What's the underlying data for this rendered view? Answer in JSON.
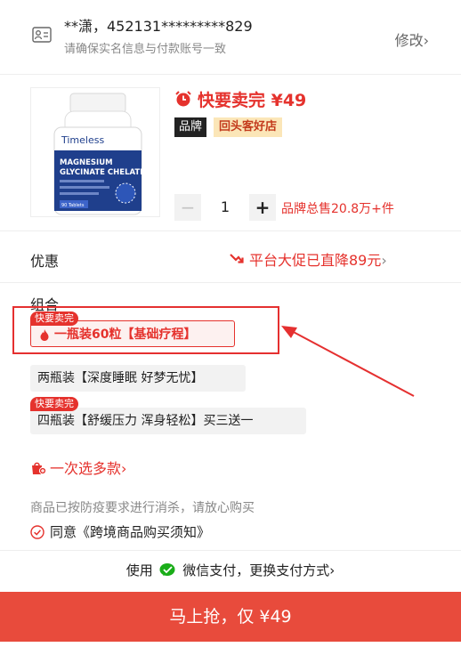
{
  "identity": {
    "name_id": "**潇，452131*********829",
    "hint": "请确保实名信息与付款账号一致",
    "modify_label": "修改",
    "modify_chevron": "›"
  },
  "product": {
    "title": "快要卖完 ¥49",
    "brand_tag": "品牌",
    "store_tag": "回头客好店",
    "quantity": "1",
    "minus": "−",
    "plus": "+",
    "total_sold": "品牌总售20.8万+件",
    "image_texts": {
      "brand": "Timeless",
      "line1": "MAGNESIUM",
      "line2": "GLYCINATE CHELATE",
      "count": "90 Tablets"
    }
  },
  "discount": {
    "label": "优惠",
    "value": "平台大促已直降89元",
    "chevron": "›"
  },
  "combo": {
    "label": "组合",
    "options": [
      {
        "badge": "快要卖完",
        "label": "一瓶装60粒【基础疗程】",
        "selected": true
      },
      {
        "badge": "",
        "label": "两瓶装【深度睡眠 好梦无忧】",
        "selected": false
      },
      {
        "badge": "快要卖完",
        "label": "四瓶装【舒缓压力 浑身轻松】买三送一",
        "selected": false
      }
    ]
  },
  "multi_select": {
    "label": "一次选多款",
    "chevron": "›"
  },
  "notice": "商品已按防疫要求进行消杀，请放心购买",
  "agreement": "同意《跨境商品购买须知》",
  "payment": {
    "prefix": "使用",
    "method": "微信支付，更换支付方式",
    "chevron": "›"
  },
  "buy_button": "马上抢，仅 ¥49",
  "colors": {
    "accent_red": "#e5322d",
    "buy_bar": "#e84b3c",
    "wechat_green": "#1aad19",
    "store_tag_bg": "#fbe6b8"
  },
  "icons": [
    "id-card-icon",
    "alarm-clock-icon",
    "discount-arrow-icon",
    "flame-icon",
    "shopping-bag-icon",
    "check-circle-icon",
    "wechat-pay-icon"
  ]
}
